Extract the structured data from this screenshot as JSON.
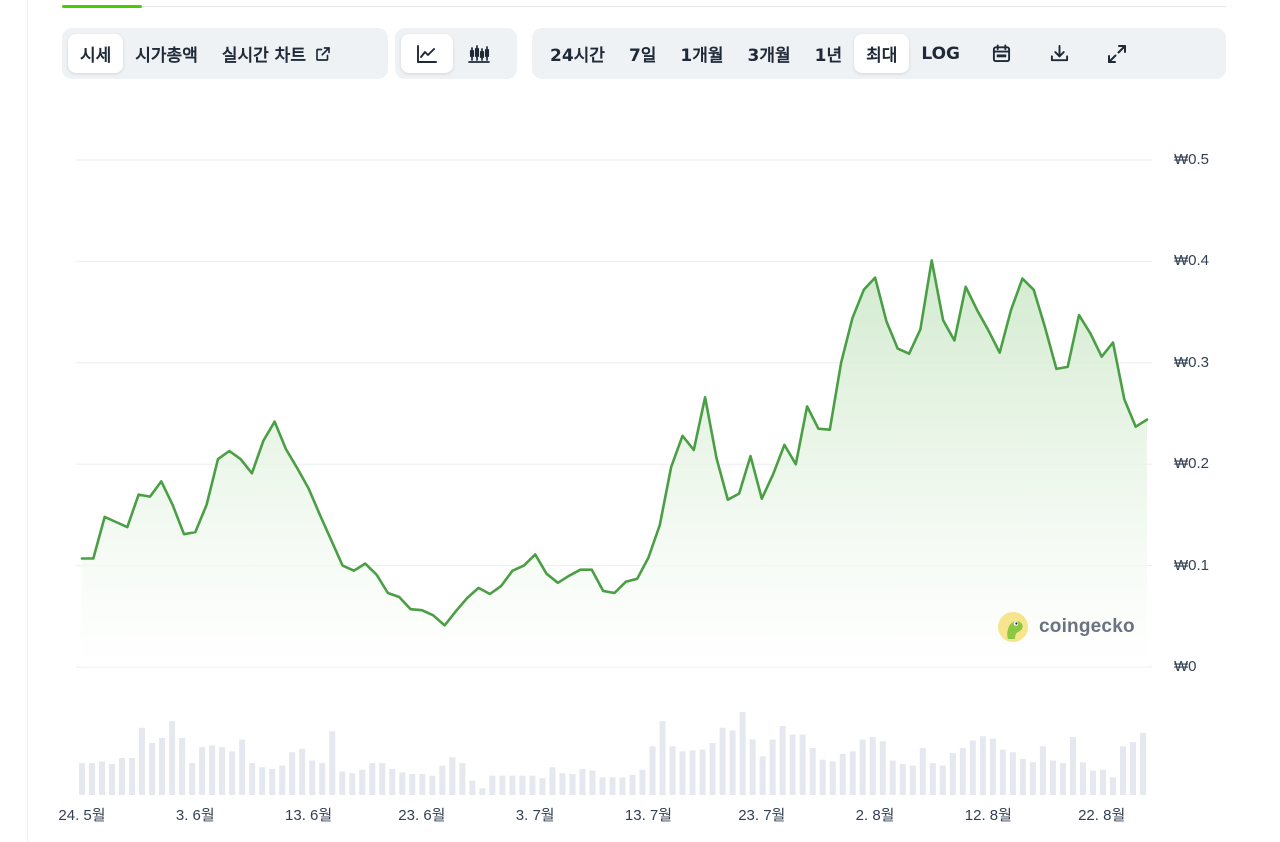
{
  "toolbar": {
    "view_tabs": [
      {
        "label": "시세",
        "active": true
      },
      {
        "label": "시가총액",
        "active": false
      },
      {
        "label": "실시간 차트",
        "active": false,
        "icon": "external-link-icon"
      }
    ],
    "chart_type": [
      {
        "icon": "line-chart-icon",
        "active": true
      },
      {
        "icon": "candlestick-icon",
        "active": false
      }
    ],
    "ranges": [
      {
        "label": "24시간",
        "active": false
      },
      {
        "label": "7일",
        "active": false
      },
      {
        "label": "1개월",
        "active": false
      },
      {
        "label": "3개월",
        "active": false
      },
      {
        "label": "1년",
        "active": false
      },
      {
        "label": "최대",
        "active": true
      },
      {
        "label": "LOG",
        "active": false
      }
    ],
    "actions": [
      "calendar-icon",
      "download-icon",
      "fullscreen-icon"
    ]
  },
  "watermark": {
    "text": "coingecko",
    "icon": "coingecko-logo"
  },
  "colors": {
    "line": "#4a9f45",
    "fill_top": "#d3ecd0",
    "grid": "#eceef1",
    "volume": "#e5e8ef",
    "accent": "#4bcc00"
  },
  "chart_data": {
    "type": "line",
    "title": "",
    "xlabel": "",
    "ylabel": "",
    "x_ticks": [
      "24. 5월",
      "3. 6월",
      "13. 6월",
      "23. 6월",
      "3. 7월",
      "13. 7월",
      "23. 7월",
      "2. 8월",
      "12. 8월",
      "22. 8월"
    ],
    "x_range": [
      "2024-05-24",
      "2024-08-26"
    ],
    "y_ticks": [
      "₩0",
      "₩0.1",
      "₩0.2",
      "₩0.3",
      "₩0.4",
      "₩0.5"
    ],
    "ylim": [
      0,
      0.5
    ],
    "grid": true,
    "area_fill": true,
    "y_axis_position": "right",
    "series": [
      {
        "x": [
          "2024-05-24",
          "2024-05-25",
          "2024-05-26",
          "2024-05-27",
          "2024-05-28",
          "2024-05-29",
          "2024-05-30",
          "2024-05-31",
          "2024-06-01",
          "2024-06-02",
          "2024-06-03",
          "2024-06-04",
          "2024-06-05",
          "2024-06-06",
          "2024-06-07",
          "2024-06-08",
          "2024-06-09",
          "2024-06-10",
          "2024-06-11",
          "2024-06-12",
          "2024-06-13",
          "2024-06-14",
          "2024-06-15",
          "2024-06-16",
          "2024-06-17",
          "2024-06-18",
          "2024-06-19",
          "2024-06-20",
          "2024-06-21",
          "2024-06-22",
          "2024-06-23",
          "2024-06-24",
          "2024-06-25",
          "2024-06-26",
          "2024-06-27",
          "2024-06-28",
          "2024-06-29",
          "2024-06-30",
          "2024-07-01",
          "2024-07-02",
          "2024-07-03",
          "2024-07-04",
          "2024-07-05",
          "2024-07-06",
          "2024-07-07",
          "2024-07-08",
          "2024-07-09",
          "2024-07-10",
          "2024-07-11",
          "2024-07-12",
          "2024-07-13",
          "2024-07-14",
          "2024-07-15",
          "2024-07-16",
          "2024-07-17",
          "2024-07-18",
          "2024-07-19",
          "2024-07-20",
          "2024-07-21",
          "2024-07-22",
          "2024-07-23",
          "2024-07-24",
          "2024-07-25",
          "2024-07-26",
          "2024-07-27",
          "2024-07-28",
          "2024-07-29",
          "2024-07-30",
          "2024-07-31",
          "2024-08-01",
          "2024-08-02",
          "2024-08-03",
          "2024-08-04",
          "2024-08-05",
          "2024-08-06",
          "2024-08-07",
          "2024-08-08",
          "2024-08-09",
          "2024-08-10",
          "2024-08-11",
          "2024-08-12",
          "2024-08-13",
          "2024-08-14",
          "2024-08-15",
          "2024-08-16",
          "2024-08-17",
          "2024-08-18",
          "2024-08-19",
          "2024-08-20",
          "2024-08-21",
          "2024-08-22",
          "2024-08-23",
          "2024-08-24",
          "2024-08-25",
          "2024-08-26"
        ],
        "y": [
          0.107,
          0.107,
          0.148,
          0.143,
          0.138,
          0.17,
          0.168,
          0.183,
          0.16,
          0.131,
          0.133,
          0.16,
          0.205,
          0.213,
          0.205,
          0.191,
          0.223,
          0.242,
          0.215,
          0.196,
          0.176,
          0.15,
          0.125,
          0.1,
          0.095,
          0.102,
          0.091,
          0.073,
          0.069,
          0.057,
          0.056,
          0.051,
          0.041,
          0.055,
          0.068,
          0.078,
          0.072,
          0.08,
          0.095,
          0.1,
          0.111,
          0.092,
          0.083,
          0.09,
          0.096,
          0.096,
          0.075,
          0.073,
          0.084,
          0.087,
          0.108,
          0.14,
          0.197,
          0.228,
          0.214,
          0.266,
          0.206,
          0.165,
          0.171,
          0.208,
          0.166,
          0.19,
          0.219,
          0.2,
          0.257,
          0.235,
          0.234,
          0.3,
          0.344,
          0.372,
          0.384,
          0.341,
          0.314,
          0.309,
          0.333,
          0.401,
          0.342,
          0.322,
          0.375,
          0.352,
          0.332,
          0.31,
          0.352,
          0.383,
          0.372,
          0.335,
          0.294,
          0.296,
          0.347,
          0.329,
          0.306,
          0.32,
          0.264,
          0.237,
          0.244
        ]
      }
    ],
    "volume": [
      0.38,
      0.38,
      0.4,
      0.37,
      0.44,
      0.44,
      0.8,
      0.62,
      0.68,
      0.88,
      0.68,
      0.38,
      0.57,
      0.59,
      0.57,
      0.52,
      0.66,
      0.38,
      0.33,
      0.31,
      0.35,
      0.51,
      0.55,
      0.41,
      0.38,
      0.76,
      0.28,
      0.26,
      0.3,
      0.38,
      0.38,
      0.31,
      0.27,
      0.25,
      0.25,
      0.23,
      0.35,
      0.45,
      0.38,
      0.17,
      0.08,
      0.23,
      0.23,
      0.23,
      0.23,
      0.23,
      0.2,
      0.33,
      0.26,
      0.25,
      0.31,
      0.29,
      0.21,
      0.21,
      0.21,
      0.24,
      0.3,
      0.58,
      0.88,
      0.58,
      0.52,
      0.53,
      0.54,
      0.62,
      0.8,
      0.77,
      0.99,
      0.66,
      0.46,
      0.66,
      0.82,
      0.72,
      0.72,
      0.56,
      0.42,
      0.4,
      0.49,
      0.52,
      0.66,
      0.69,
      0.64,
      0.41,
      0.37,
      0.35,
      0.56,
      0.38,
      0.35,
      0.5,
      0.56,
      0.65,
      0.7,
      0.67,
      0.54,
      0.51,
      0.43,
      0.39,
      0.58,
      0.41,
      0.38,
      0.69,
      0.39,
      0.29,
      0.3,
      0.21,
      0.58,
      0.63,
      0.74
    ]
  }
}
